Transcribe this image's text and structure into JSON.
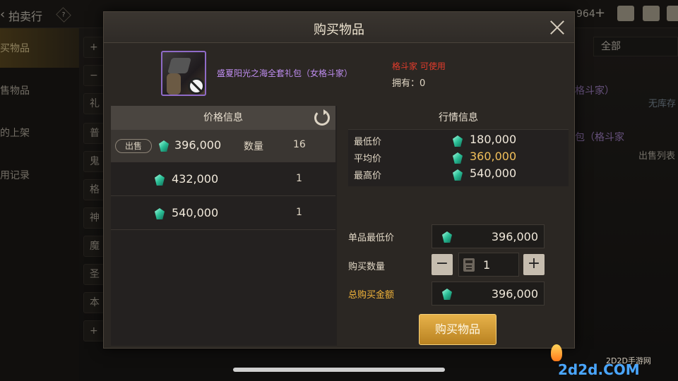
{
  "background": {
    "back_glyph": "‹",
    "title": "拍卖行",
    "help_glyph": "?",
    "currency_value": "964",
    "plus_glyph": "+",
    "sidebar": [
      {
        "label": "买物品",
        "active": true
      },
      {
        "label": "售物品",
        "active": false
      },
      {
        "label": "的上架",
        "active": false
      },
      {
        "label": "用记录",
        "active": false
      }
    ],
    "categories": [
      "+",
      "−",
      "礼",
      "普",
      "鬼",
      "格",
      "神",
      "魔",
      "圣",
      "本",
      "+"
    ],
    "filter_label": "全部",
    "rows": [
      {
        "name": "格斗家）",
        "status": "无库存"
      },
      {
        "name": "包（格斗家",
        "status": "出售列表"
      }
    ]
  },
  "modal": {
    "title": "购买物品",
    "item": {
      "name": "盛夏阳光之海全套礼包（女格斗家）",
      "class_text": "格斗家 可使用",
      "own_label": "拥有：",
      "own_value": "0"
    },
    "price_panel": {
      "header": "价格信息",
      "rows": [
        {
          "tag": "出售",
          "price": "396,000",
          "qty_label": "数量",
          "qty": "16",
          "selected": true
        },
        {
          "tag": "",
          "price": "432,000",
          "qty_label": "",
          "qty": "1",
          "selected": false
        },
        {
          "tag": "",
          "price": "540,000",
          "qty_label": "",
          "qty": "1",
          "selected": false
        }
      ]
    },
    "market_panel": {
      "header": "行情信息",
      "rows": [
        {
          "label": "最低价",
          "value": "180,000",
          "highlight": false
        },
        {
          "label": "平均价",
          "value": "360,000",
          "highlight": true
        },
        {
          "label": "最高价",
          "value": "540,000",
          "highlight": false
        }
      ]
    },
    "form": {
      "unit_min_label": "单品最低价",
      "unit_min_value": "396,000",
      "qty_label": "购买数量",
      "qty_value": "1",
      "minus": "−",
      "plus": "+",
      "total_label": "总购买金额",
      "total_value": "396,000"
    },
    "buy_button": "购买物品"
  },
  "watermark": {
    "text": "2D2D手游网",
    "logo": "2d2d.COM"
  },
  "colors": {
    "item_name": "#c08ef2",
    "class_warning": "#e43c2c",
    "average_price": "#f2c05a",
    "total_label": "#f2b43a",
    "buy_button": "#d9a23a"
  }
}
